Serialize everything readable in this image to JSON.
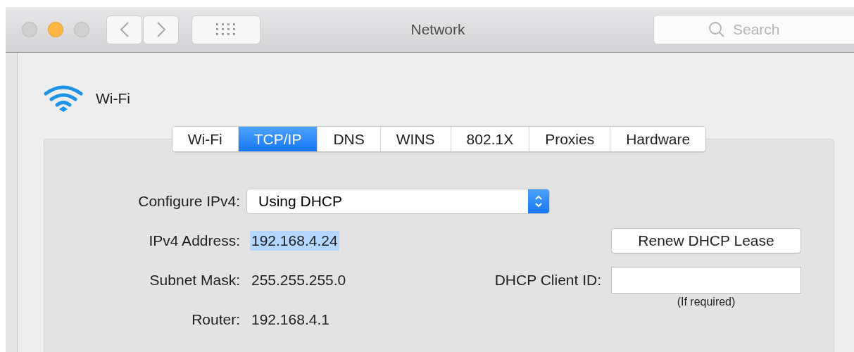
{
  "window": {
    "title": "Network",
    "traffic_lights": [
      {
        "color": "#d0d0d0"
      },
      {
        "color": "#fdb543"
      },
      {
        "color": "#d0d0d0"
      }
    ]
  },
  "search": {
    "placeholder": "Search"
  },
  "header": {
    "title": "Wi-Fi"
  },
  "tabs": [
    {
      "label": "Wi-Fi",
      "selected": false
    },
    {
      "label": "TCP/IP",
      "selected": true
    },
    {
      "label": "DNS",
      "selected": false
    },
    {
      "label": "WINS",
      "selected": false
    },
    {
      "label": "802.1X",
      "selected": false
    },
    {
      "label": "Proxies",
      "selected": false
    },
    {
      "label": "Hardware",
      "selected": false
    }
  ],
  "configure": {
    "label": "Configure IPv4:",
    "value": "Using DHCP"
  },
  "rows": [
    {
      "label": "IPv4 Address:",
      "value": "192.168.4.24",
      "selected": true
    },
    {
      "label": "Subnet Mask:",
      "value": "255.255.255.0",
      "selected": false
    },
    {
      "label": "Router:",
      "value": "192.168.4.1",
      "selected": false
    }
  ],
  "renew_button": "Renew DHCP Lease",
  "client_id": {
    "label": "DHCP Client ID:",
    "note": "(If required)"
  }
}
